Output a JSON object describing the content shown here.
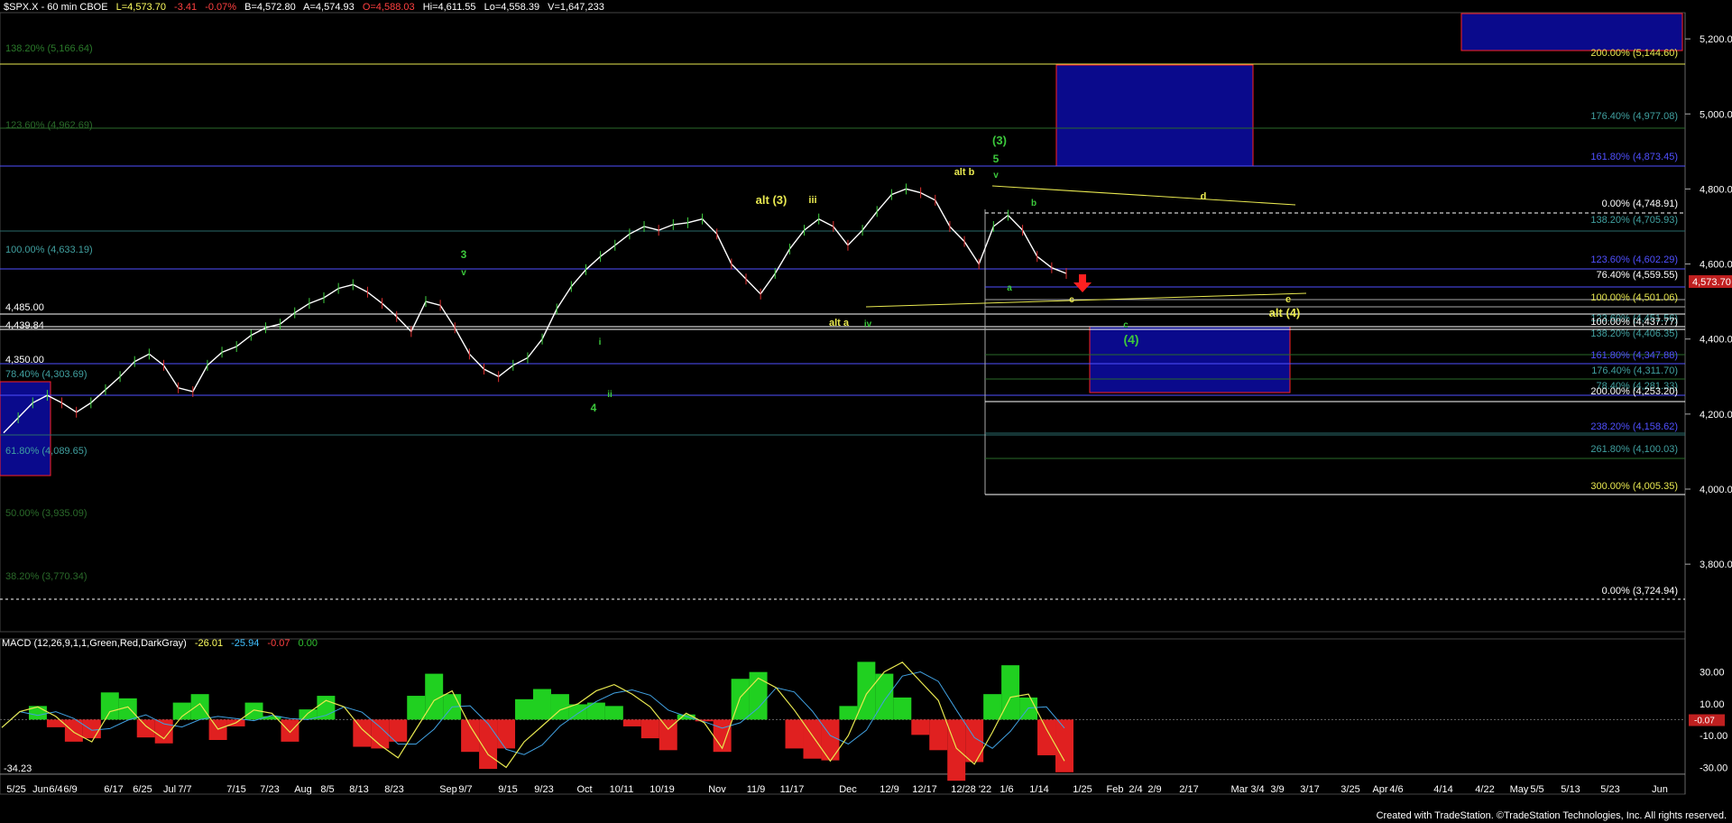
{
  "header": {
    "symbol": "$SPX.X - 60 min  CBOE",
    "last": "L=4,573.70",
    "change": "-3.41",
    "pct": "-0.07%",
    "bid": "B=4,572.80",
    "ask": "A=4,574.93",
    "open": "O=4,588.03",
    "high": "Hi=4,611.55",
    "low": "Lo=4,558.39",
    "volume": "V=1,647,233"
  },
  "colors": {
    "yellow": "#e8e850",
    "green": "#3cc83c",
    "blue": "#5050ff",
    "red": "#ff2020",
    "navy": "#0a0a8c",
    "price": "#ffffff",
    "teal": "#40a0a0"
  },
  "price_axis": {
    "ticks": [
      "5,200.00",
      "5,000.00",
      "4,800.00",
      "4,600.00",
      "4,400.00",
      "4,200.00",
      "4,000.00",
      "3,800.00"
    ],
    "last_label": "4,573.70"
  },
  "macd_axis": {
    "ticks": [
      "30.00",
      "10.00",
      "-10.00",
      "-30.00"
    ],
    "last_label": "-0.07"
  },
  "macd_header": {
    "title": "MACD (12,26,9,1,1,Green,Red,DarkGray)",
    "macd": "-26.01",
    "signal": "-25.94",
    "diff": "-0.07",
    "zero": "0.00"
  },
  "macd_min_label": "-34.23",
  "x_labels": [
    "5/25",
    "Jun",
    "6/4",
    "6/9",
    "6/17",
    "6/25",
    "Jul",
    "7/7",
    "7/15",
    "7/23",
    "Aug",
    "8/5",
    "8/13",
    "8/23",
    "Sep",
    "9/7",
    "9/15",
    "9/23",
    "Oct",
    "10/11",
    "10/19",
    "Nov",
    "11/9",
    "11/17",
    "Dec",
    "12/9",
    "12/17",
    "12/28",
    "'22",
    "1/6",
    "1/14",
    "1/25",
    "Feb",
    "2/4",
    "2/9",
    "2/17",
    "Mar",
    "3/4",
    "3/9",
    "3/17",
    "3/25",
    "Apr",
    "4/6",
    "4/14",
    "4/22",
    "May",
    "5/5",
    "5/13",
    "5/23",
    "Jun"
  ],
  "fib_right": [
    "200.00% (5,144.60)",
    "176.40% (4,977.08)",
    "161.80% (4,873.45)",
    "0.00% (4,748.91)",
    "138.20% (4,705.93)",
    "123.60% (4,602.29)",
    "76.40% (4,559.55)",
    "100.00% (4,501.06)",
    "123.60% (4,451.56)",
    "100.00% (4,437.77)",
    "138.20% (4,406.35)",
    "161.80% (4,347.88)",
    "176.40% (4,311.70)",
    "78.40% (4,281.33)",
    "200.00% (4,253.20)",
    "238.20% (4,158.62)",
    "261.80% (4,100.03)",
    "300.00% (4,005.35)",
    "0.00% (3,724.94)"
  ],
  "fib_left": [
    "138.20% (5,166.64)",
    "123.60% (4,962.69)",
    "100.00% (4,633.19)",
    "4,485.00",
    "4,439.84",
    "4,350.00",
    "78.40% (4,303.69)",
    "61.80% (4,089.65)",
    "50.00% (3,935.09)",
    "38.20% (3,770.34)"
  ],
  "wave_labels": {
    "w3_green": "3",
    "w3_v": "v",
    "w4_green": "4",
    "w_i": "i",
    "w_ii": "ii",
    "w_iii": "iii",
    "w_iv": "iv",
    "w_v": "v",
    "alt3": "alt (3)",
    "alt_a": "alt a",
    "alt_b": "alt b",
    "p3": "(3)",
    "p5": "5",
    "a": "a",
    "b": "b",
    "c": "c",
    "d": "d",
    "e": "e",
    "c2": "c",
    "p4": "(4)",
    "alt4": "alt (4)"
  },
  "credit": "Created with TradeStation. ©TradeStation Technologies, Inc. All rights reserved.",
  "chart_data": {
    "type": "line",
    "title": "$SPX.X - 60 min",
    "ylabel": "",
    "xlabel": "",
    "ylim": [
      3620,
      5270
    ],
    "series": [
      {
        "values": [
          4150,
          4190,
          4230,
          4250,
          4230,
          4205,
          4230,
          4265,
          4300,
          4340,
          4360,
          4330,
          4270,
          4260,
          4330,
          4365,
          4380,
          4410,
          4430,
          4440,
          4470,
          4495,
          4510,
          4535,
          4545,
          4525,
          4495,
          4460,
          4420,
          4500,
          4490,
          4430,
          4360,
          4320,
          4300,
          4330,
          4350,
          4400,
          4480,
          4540,
          4585,
          4620,
          4650,
          4680,
          4700,
          4690,
          4705,
          4710,
          4720,
          4680,
          4600,
          4560,
          4520,
          4575,
          4640,
          4690,
          4720,
          4700,
          4650,
          4690,
          4740,
          4785,
          4800,
          4790,
          4770,
          4700,
          4660,
          4600,
          4700,
          4730,
          4690,
          4620,
          4590,
          4575
        ]
      }
    ],
    "macd": [
      -5,
      5,
      8,
      2,
      -8,
      -14,
      5,
      8,
      -4,
      -12,
      2,
      10,
      -6,
      -2,
      6,
      4,
      -8,
      4,
      12,
      8,
      -6,
      -16,
      -24,
      -6,
      12,
      18,
      -4,
      -22,
      -30,
      -14,
      -4,
      6,
      10,
      18,
      22,
      16,
      8,
      -6,
      4,
      -2,
      -18,
      14,
      26,
      20,
      6,
      -10,
      -26,
      -10,
      16,
      30,
      36,
      24,
      12,
      -18,
      -28,
      -8,
      14,
      16,
      -6,
      -26
    ]
  }
}
